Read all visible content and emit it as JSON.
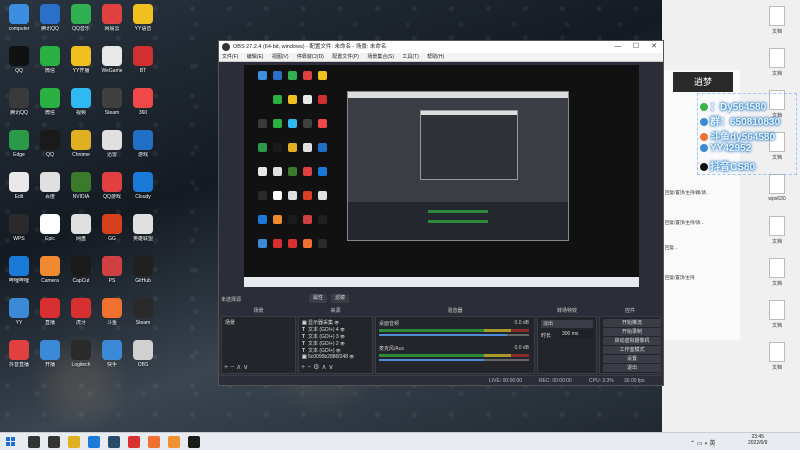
{
  "desktop": {
    "icons": [
      {
        "label": "computer",
        "color": "#3c8ee0"
      },
      {
        "label": "腾讯QQ",
        "color": "#2a6fc8"
      },
      {
        "label": "QQ音乐",
        "color": "#30b050"
      },
      {
        "label": "网易云",
        "color": "#e04040"
      },
      {
        "label": "YY语音",
        "color": "#f0c020"
      },
      {
        "label": "QQ",
        "color": "#111111"
      },
      {
        "label": "微信",
        "color": "#2ab040"
      },
      {
        "label": "YY开播",
        "color": "#f0c020"
      },
      {
        "label": "WeGame",
        "color": "#e8e8e8"
      },
      {
        "label": "BT",
        "color": "#d03030"
      },
      {
        "label": "腾讯QQ",
        "color": "#3a3a3a"
      },
      {
        "label": "微信",
        "color": "#2ab040"
      },
      {
        "label": "视频",
        "color": "#30b8f0"
      },
      {
        "label": "Steam",
        "color": "#404040"
      },
      {
        "label": "360",
        "color": "#f04848"
      },
      {
        "label": "Edge",
        "color": "#2a9a48"
      },
      {
        "label": "QQ",
        "color": "#1a1a1a"
      },
      {
        "label": "Chrome",
        "color": "#e0b020"
      },
      {
        "label": "迅雷",
        "color": "#e0e0e0"
      },
      {
        "label": "游戏",
        "color": "#2070c8"
      },
      {
        "label": "Edit",
        "color": "#e8e8e8"
      },
      {
        "label": "百度",
        "color": "#e0e0e0"
      },
      {
        "label": "NVIDIA",
        "color": "#3a7a2a"
      },
      {
        "label": "QQ游戏",
        "color": "#e04040"
      },
      {
        "label": "Cloudy",
        "color": "#1a7ad8"
      },
      {
        "label": "WPS",
        "color": "#2a2a2a"
      },
      {
        "label": "Epic",
        "color": "#ffffff"
      },
      {
        "label": "网盘",
        "color": "#e0e0e0"
      },
      {
        "label": "GG",
        "color": "#d84020"
      },
      {
        "label": "英雄联盟",
        "color": "#e0e0e0"
      },
      {
        "label": "哔哩哔哩",
        "color": "#1a7ad8"
      },
      {
        "label": "Camera",
        "color": "#f08a30"
      },
      {
        "label": "CapCut",
        "color": "#1a1a1a"
      },
      {
        "label": "PS",
        "color": "#d04040"
      },
      {
        "label": "GitHub",
        "color": "#202020"
      },
      {
        "label": "YY",
        "color": "#3a8ad8"
      },
      {
        "label": "直播",
        "color": "#d83030"
      },
      {
        "label": "虎牙",
        "color": "#d83030"
      },
      {
        "label": "斗鱼",
        "color": "#f07030"
      },
      {
        "label": "Steam",
        "color": "#2a2a2a"
      },
      {
        "label": "抖音直播",
        "color": "#e04040"
      },
      {
        "label": "开播",
        "color": "#3a8ad8"
      },
      {
        "label": "Logitech",
        "color": "#2a2a2a"
      },
      {
        "label": "快手",
        "color": "#3a8ad8"
      },
      {
        "label": "OBS",
        "color": "#d0d0d0"
      }
    ],
    "right_files": [
      {
        "label": "文档"
      },
      {
        "label": "文档"
      },
      {
        "label": "文档"
      },
      {
        "label": "文档"
      },
      {
        "label": "wps630"
      },
      {
        "label": "文档"
      },
      {
        "label": "文档"
      },
      {
        "label": "文档"
      },
      {
        "label": "文档"
      }
    ]
  },
  "overlay": {
    "lines": [
      {
        "icon_color": "#3ab34a",
        "text": "：Dy564580"
      },
      {
        "icon_color": "#3a8ad8",
        "text": "群：650810830"
      },
      {
        "icon_color": "#f07030",
        "text": "斗鱼dy564580"
      },
      {
        "icon_color": "#3a8ad8",
        "text": "YY42952"
      },
      {
        "icon_color": "#111111",
        "text": "抖音CS80"
      }
    ]
  },
  "chat": {
    "logo": "逍梦",
    "lines": [
      "回复/置顶/主持/踢/请...",
      "回复/置顶/主持/请...",
      "回复...",
      "回复/置顶/主持"
    ]
  },
  "obs": {
    "title": "OBS 27.2.4 (64-bit, windows) - 配置文件: 未命名 - 场景: 未命名",
    "menu": [
      "文件(F)",
      "编辑(E)",
      "视图(V)",
      "停靠窗口(D)",
      "配置文件(P)",
      "场景集合(S)",
      "工具(T)",
      "帮助(H)"
    ],
    "scene_label": "未选择源",
    "properties_btn": "属性",
    "filters_btn": "滤镜",
    "docks": {
      "scenes": "场景",
      "sources": "来源",
      "mixer": "混音器",
      "transitions": "转场特效",
      "controls": "控件"
    },
    "scene_items": [
      "场景"
    ],
    "sources": [
      {
        "type": "img",
        "name": "显示器采集"
      },
      {
        "type": "T",
        "name": "文本 (GDI+) 4"
      },
      {
        "type": "T",
        "name": "文本 (GDI+) 3"
      },
      {
        "type": "T",
        "name": "文本 (GDI+) 2"
      },
      {
        "type": "T",
        "name": "文本 (GDI+)"
      },
      {
        "type": "img",
        "name": "5c0095b2886f248"
      }
    ],
    "mixer": [
      {
        "name": "桌面音频",
        "level": "0.0 dB",
        "volume": 0.85
      },
      {
        "name": "麦克风/Aux",
        "level": "0.0 dB",
        "volume": 0.7
      }
    ],
    "transition": {
      "type": "淡出",
      "duration_label": "时长",
      "duration": "300 ms"
    },
    "controls": [
      "开始推流",
      "开始录制",
      "启动虚拟摄像机",
      "工作室模式",
      "设置",
      "退出"
    ],
    "status": {
      "live": "LIVE: 00:00:00",
      "rec": "REC: 00:00:00",
      "cpu": "CPU: 3.3%",
      "fps": "30.00 fps"
    }
  },
  "taskbar": {
    "apps": [
      {
        "name": "search",
        "color": "#333333"
      },
      {
        "name": "taskview",
        "color": "#333333"
      },
      {
        "name": "explorer",
        "color": "#e0b020"
      },
      {
        "name": "edge",
        "color": "#1a7ad8"
      },
      {
        "name": "steam",
        "color": "#2a4a6a"
      },
      {
        "name": "app1",
        "color": "#d83030"
      },
      {
        "name": "app2",
        "color": "#f07030"
      },
      {
        "name": "app3",
        "color": "#f09030"
      },
      {
        "name": "obs",
        "color": "#1a1a1a"
      }
    ],
    "time": "23:45",
    "date": "2022/6/9"
  }
}
